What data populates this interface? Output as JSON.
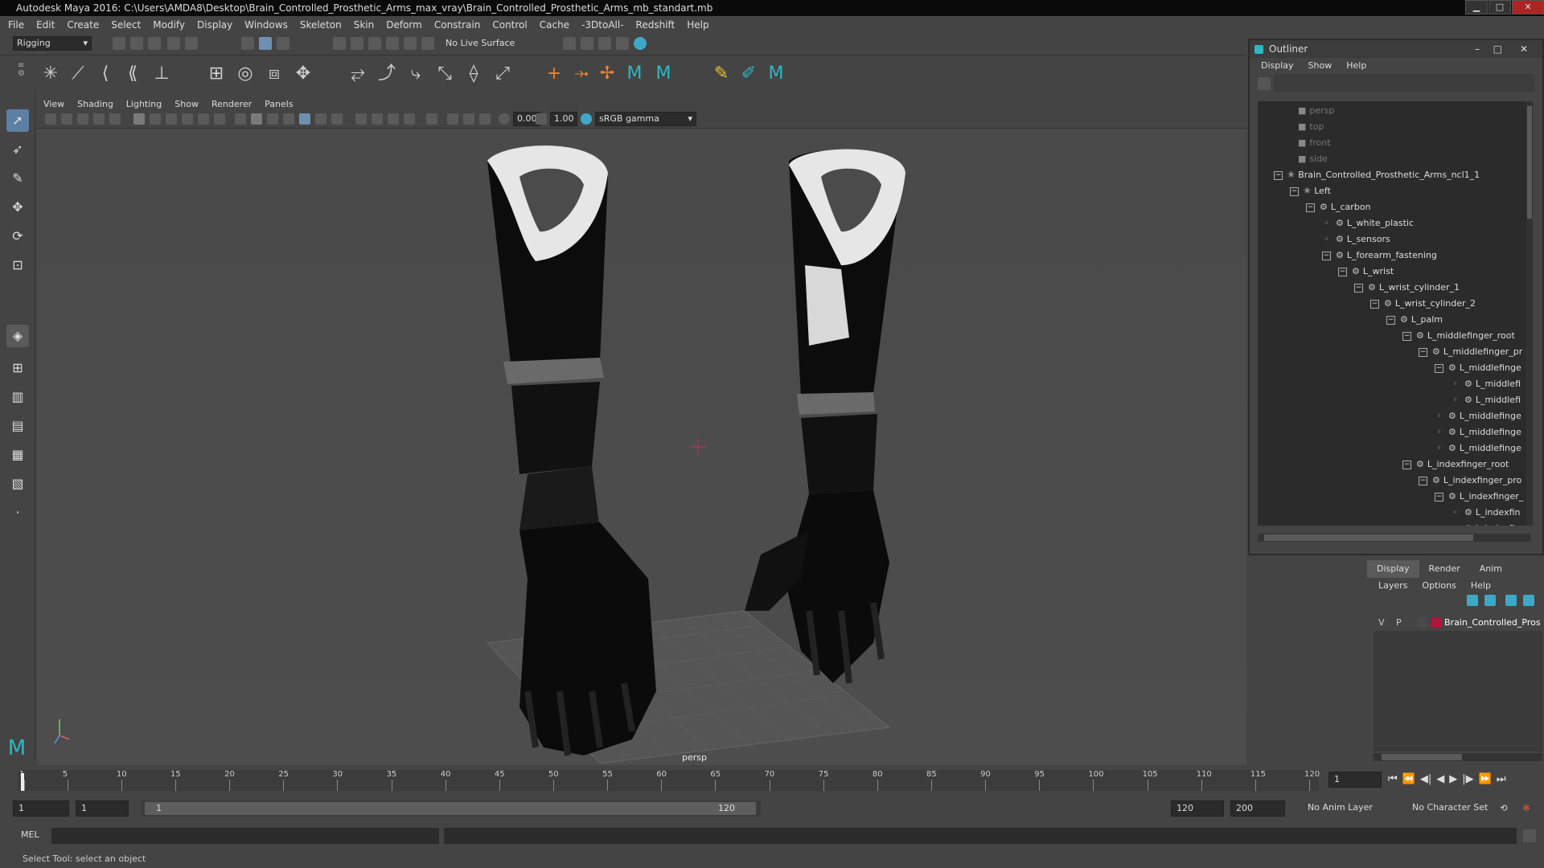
{
  "window": {
    "title": "Autodesk Maya 2016: C:\\Users\\AMDA8\\Desktop\\Brain_Controlled_Prosthetic_Arms_max_vray\\Brain_Controlled_Prosthetic_Arms_mb_standart.mb"
  },
  "menubar": [
    "File",
    "Edit",
    "Create",
    "Select",
    "Modify",
    "Display",
    "Windows",
    "Skeleton",
    "Skin",
    "Deform",
    "Constrain",
    "Control",
    "Cache",
    "-3DtoAll-",
    "Redshift",
    "Help"
  ],
  "statusline": {
    "menuset": "Rigging",
    "live_surface": "No Live Surface"
  },
  "viewport": {
    "menus": [
      "View",
      "Shading",
      "Lighting",
      "Show",
      "Renderer",
      "Panels"
    ],
    "exposure": "0.00",
    "gamma": "1.00",
    "color_space": "sRGB gamma",
    "camera_label": "persp"
  },
  "outliner": {
    "title": "Outliner",
    "menus": [
      "Display",
      "Show",
      "Help"
    ],
    "items": [
      {
        "label": "persp",
        "depth": 0,
        "icon": "camera-icon",
        "dim": true
      },
      {
        "label": "top",
        "depth": 0,
        "icon": "camera-icon",
        "dim": true
      },
      {
        "label": "front",
        "depth": 0,
        "icon": "camera-icon",
        "dim": true
      },
      {
        "label": "side",
        "depth": 0,
        "icon": "camera-icon",
        "dim": true
      },
      {
        "label": "Brain_Controlled_Prosthetic_Arms_ncl1_1",
        "depth": 0,
        "icon": "joint-icon",
        "expand": "−"
      },
      {
        "label": "Left",
        "depth": 1,
        "icon": "joint-icon",
        "expand": "−"
      },
      {
        "label": "L_carbon",
        "depth": 2,
        "icon": "transform-icon",
        "expand": "−"
      },
      {
        "label": "L_white_plastic",
        "depth": 3,
        "icon": "transform-icon"
      },
      {
        "label": "L_sensors",
        "depth": 3,
        "icon": "transform-icon"
      },
      {
        "label": "L_forearm_fastening",
        "depth": 3,
        "icon": "transform-icon",
        "expand": "−"
      },
      {
        "label": "L_wrist",
        "depth": 4,
        "icon": "transform-icon",
        "expand": "−"
      },
      {
        "label": "L_wrist_cylinder_1",
        "depth": 5,
        "icon": "transform-icon",
        "expand": "−"
      },
      {
        "label": "L_wrist_cylinder_2",
        "depth": 6,
        "icon": "transform-icon",
        "expand": "−"
      },
      {
        "label": "L_palm",
        "depth": 7,
        "icon": "transform-icon",
        "expand": "−"
      },
      {
        "label": "L_middlefinger_root",
        "depth": 8,
        "icon": "transform-icon",
        "expand": "−"
      },
      {
        "label": "L_middlefinger_pr",
        "depth": 9,
        "icon": "transform-icon",
        "expand": "−"
      },
      {
        "label": "L_middlefinge",
        "depth": 10,
        "icon": "transform-icon",
        "expand": "−"
      },
      {
        "label": "L_middlefi",
        "depth": 11,
        "icon": "transform-icon"
      },
      {
        "label": "L_middlefi",
        "depth": 11,
        "icon": "transform-icon"
      },
      {
        "label": "L_middlefinge",
        "depth": 10,
        "icon": "transform-icon"
      },
      {
        "label": "L_middlefinge",
        "depth": 10,
        "icon": "transform-icon"
      },
      {
        "label": "L_middlefinge",
        "depth": 10,
        "icon": "transform-icon"
      },
      {
        "label": "L_indexfinger_root",
        "depth": 8,
        "icon": "transform-icon",
        "expand": "−"
      },
      {
        "label": "L_indexfinger_pro",
        "depth": 9,
        "icon": "transform-icon",
        "expand": "−"
      },
      {
        "label": "L_indexfinger_",
        "depth": 10,
        "icon": "transform-icon",
        "expand": "−"
      },
      {
        "label": "L_indexfin",
        "depth": 11,
        "icon": "transform-icon"
      },
      {
        "label": "L_indexfin",
        "depth": 11,
        "icon": "transform-icon"
      }
    ]
  },
  "layers": {
    "tabs": [
      "Display",
      "Render",
      "Anim"
    ],
    "menus": [
      "Layers",
      "Options",
      "Help"
    ],
    "layer": {
      "v": "V",
      "p": "P",
      "name": "Brain_Controlled_Pros",
      "color": "#b3143c"
    }
  },
  "timeline": {
    "ticks": [
      "1",
      "5",
      "10",
      "15",
      "20",
      "25",
      "30",
      "35",
      "40",
      "45",
      "50",
      "55",
      "60",
      "65",
      "70",
      "75",
      "80",
      "85",
      "90",
      "95",
      "100",
      "105",
      "110",
      "115",
      "120"
    ],
    "current_frame": "1"
  },
  "range": {
    "start": "1",
    "playback_start": "1",
    "slider_start": "1",
    "slider_end": "120",
    "playback_end": "120",
    "end": "200",
    "anim_layer": "No Anim Layer",
    "character_set": "No Character Set"
  },
  "mel": {
    "label": "MEL"
  },
  "help_line": "Select Tool: select an object"
}
